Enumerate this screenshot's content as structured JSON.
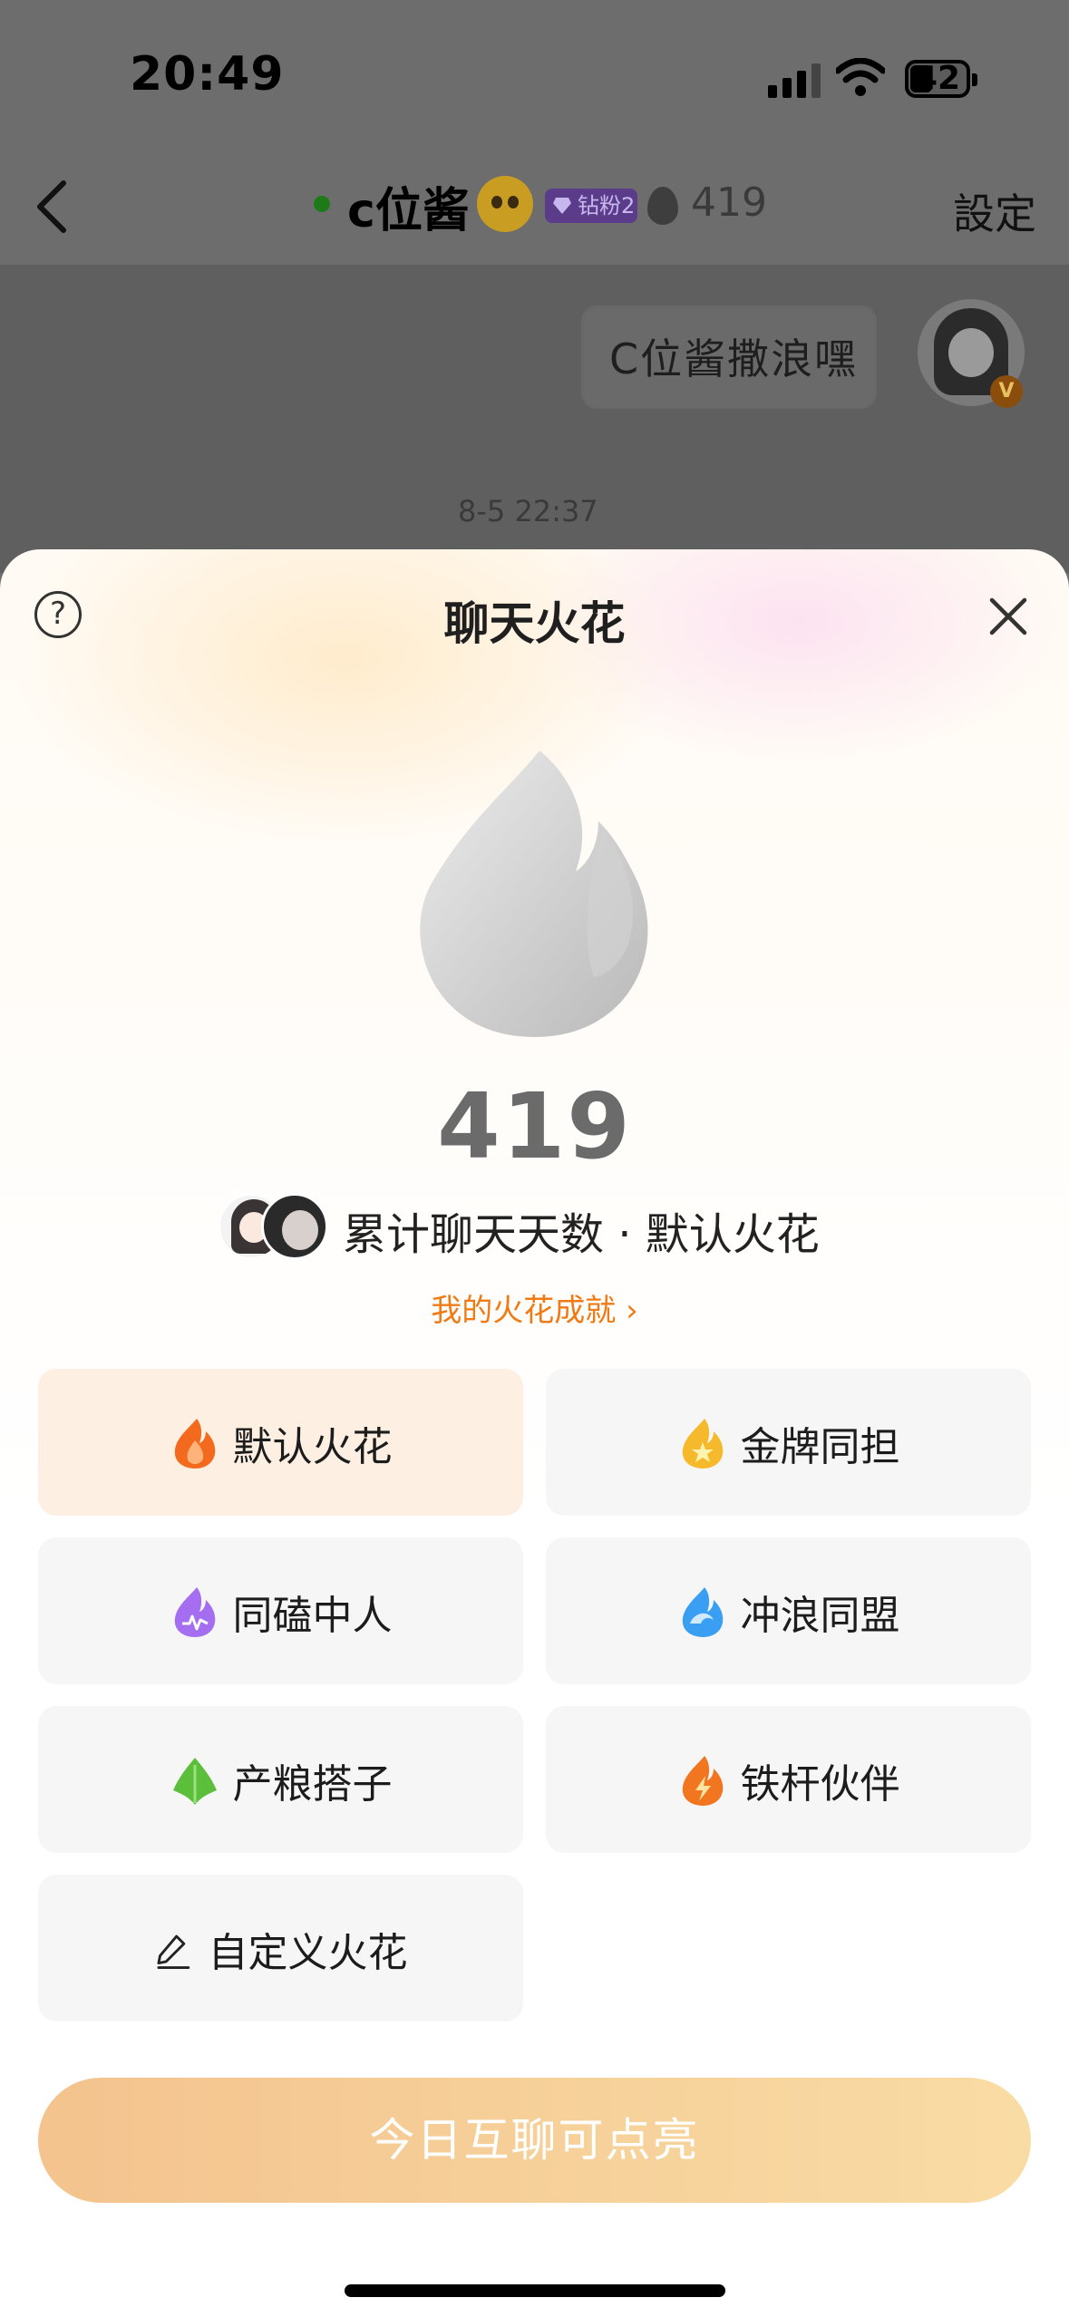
{
  "status_bar": {
    "time": "20:49",
    "battery": "42"
  },
  "nav": {
    "name": "c位酱",
    "badge": "钻粉2",
    "spark_count": "419",
    "settings": "設定"
  },
  "chat": {
    "message": "C位酱撒浪嘿",
    "timestamp": "8-5 22:37",
    "avatar_badge": "V"
  },
  "sheet": {
    "help_glyph": "?",
    "title": "聊天火花",
    "count": "419",
    "summary": "累计聊天天数 · 默认火花",
    "achievement_link": "我的火花成就 ›",
    "options": [
      {
        "label": "默认火花",
        "icon": "orange-flame-icon",
        "selected": true
      },
      {
        "label": "金牌同担",
        "icon": "gold-star-flame-icon",
        "selected": false
      },
      {
        "label": "同磕中人",
        "icon": "purple-flame-icon",
        "selected": false
      },
      {
        "label": "冲浪同盟",
        "icon": "wave-icon",
        "selected": false
      },
      {
        "label": "产粮搭子",
        "icon": "leaf-icon",
        "selected": false
      },
      {
        "label": "铁杆伙伴",
        "icon": "lightning-flame-icon",
        "selected": false
      },
      {
        "label": "自定义火花",
        "icon": "edit-icon",
        "selected": false
      }
    ],
    "cta": "今日互聊可点亮"
  },
  "colors": {
    "accent": "#f07a14",
    "selected_bg": "#fdf0e2",
    "cta_from": "#f4c38e",
    "cta_to": "#f9dca4"
  }
}
